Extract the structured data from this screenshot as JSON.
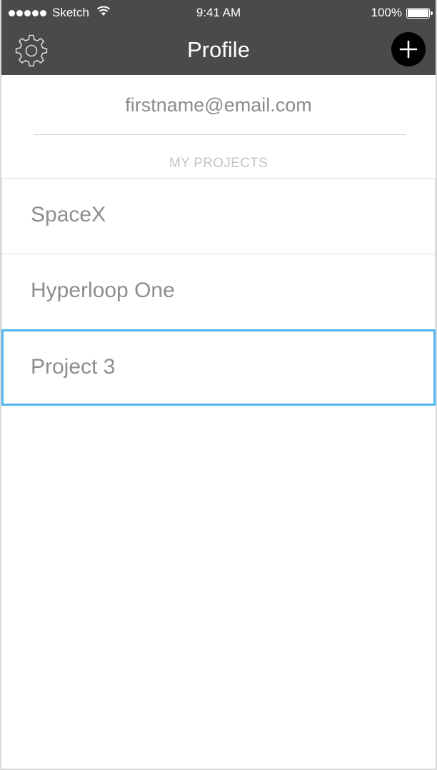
{
  "status_bar": {
    "carrier": "Sketch",
    "time": "9:41 AM",
    "battery": "100%",
    "signal_bars": 5,
    "wifi_icon": "wifi-icon",
    "battery_icon": "battery-icon"
  },
  "nav": {
    "title": "Profile",
    "left_icon": "gear-icon",
    "right_icon": "plus-icon"
  },
  "profile": {
    "email": "firstname@email.com"
  },
  "projects": {
    "header": "MY PROJECTS",
    "items": [
      {
        "label": "SpaceX",
        "selected": false
      },
      {
        "label": "Hyperloop One",
        "selected": false
      },
      {
        "label": "Project 3",
        "selected": true
      }
    ]
  },
  "colors": {
    "nav_background": "#4a4a4a",
    "selection_border": "#4fb8f0",
    "text_gray": "#8e8e8e",
    "header_gray": "#c4c4c4"
  }
}
